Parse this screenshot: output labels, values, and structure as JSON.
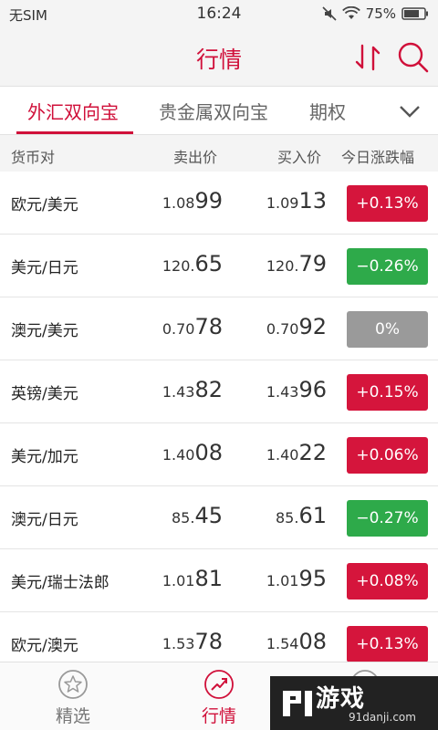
{
  "status_bar": {
    "carrier": "无SIM",
    "time": "16:24",
    "battery": "75%",
    "icons": [
      "mute-icon",
      "wifi-icon",
      "battery-icon"
    ]
  },
  "header": {
    "title": "行情",
    "icons": [
      "sort-icon",
      "search-icon"
    ],
    "accent_color": "#d0103a"
  },
  "tabs": [
    {
      "label": "外汇双向宝",
      "active": true
    },
    {
      "label": "贵金属双向宝",
      "active": false
    },
    {
      "label": "期权",
      "active": false
    }
  ],
  "columns": {
    "pair": "货币对",
    "sell": "卖出价",
    "buy": "买入价",
    "change": "今日涨跌幅"
  },
  "rows": [
    {
      "pair": "欧元/美元",
      "sell_a": "1.08",
      "sell_b": "99",
      "buy_a": "1.09",
      "buy_b": "13",
      "change": "+0.13%",
      "trend": "up"
    },
    {
      "pair": "美元/日元",
      "sell_a": "120.",
      "sell_b": "65",
      "buy_a": "120.",
      "buy_b": "79",
      "change": "−0.26%",
      "trend": "down"
    },
    {
      "pair": "澳元/美元",
      "sell_a": "0.70",
      "sell_b": "78",
      "buy_a": "0.70",
      "buy_b": "92",
      "change": "0%",
      "trend": "flat"
    },
    {
      "pair": "英镑/美元",
      "sell_a": "1.43",
      "sell_b": "82",
      "buy_a": "1.43",
      "buy_b": "96",
      "change": "+0.15%",
      "trend": "up"
    },
    {
      "pair": "美元/加元",
      "sell_a": "1.40",
      "sell_b": "08",
      "buy_a": "1.40",
      "buy_b": "22",
      "change": "+0.06%",
      "trend": "up"
    },
    {
      "pair": "澳元/日元",
      "sell_a": "85.",
      "sell_b": "45",
      "buy_a": "85.",
      "buy_b": "61",
      "change": "−0.27%",
      "trend": "down"
    },
    {
      "pair": "美元/瑞士法郎",
      "sell_a": "1.01",
      "sell_b": "81",
      "buy_a": "1.01",
      "buy_b": "95",
      "change": "+0.08%",
      "trend": "up"
    },
    {
      "pair": "欧元/澳元",
      "sell_a": "1.53",
      "sell_b": "78",
      "buy_a": "1.54",
      "buy_b": "08",
      "change": "+0.13%",
      "trend": "up"
    }
  ],
  "trend_colors": {
    "up": "#d5153c",
    "down": "#2eaa4a",
    "flat": "#9a9a9a"
  },
  "bottom_nav": [
    {
      "label": "精选",
      "icon": "star-icon",
      "active": false
    },
    {
      "label": "行情",
      "icon": "trend-icon",
      "active": true
    }
  ],
  "watermark": {
    "text": "游戏",
    "sub": "91danji.com"
  }
}
